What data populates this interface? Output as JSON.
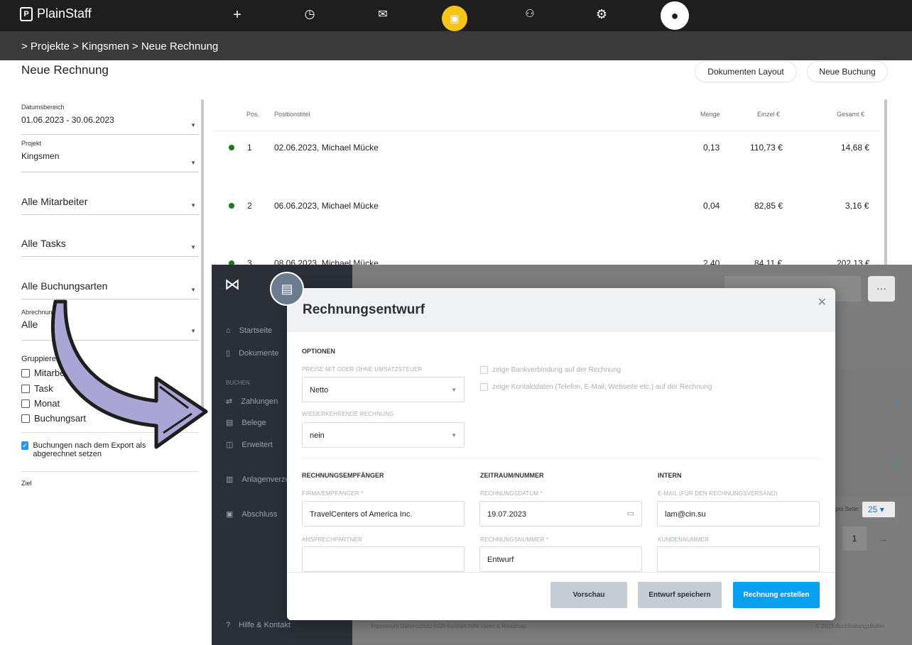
{
  "topbar": {
    "brand": "PlainStaff",
    "icons": [
      "plus-icon",
      "clock-icon",
      "mail-icon",
      "briefcase-icon",
      "team-icon",
      "gear-icon",
      "user-avatar-icon"
    ]
  },
  "breadcrumb": "> Projekte > Kingsmen > Neue Rechnung",
  "page_title": "Neue Rechnung",
  "buttons": {
    "layout": "Dokumenten Layout",
    "new_booking": "Neue Buchung"
  },
  "filters": {
    "date_label": "Datumsbereich",
    "date_value": "01.06.2023 - 30.06.2023",
    "project_label": "Projekt",
    "project_value": "Kingsmen",
    "employees": "Alle Mitarbeiter",
    "tasks": "Alle Tasks",
    "booking_types": "Alle Buchungsarten",
    "billing_label": "Abrechnung",
    "billing_value": "Alle"
  },
  "group_by": {
    "label": "Gruppieren nach",
    "options": [
      "Mitarbeiter",
      "Task",
      "Monat",
      "Buchungsart"
    ]
  },
  "export_option": "Buchungen nach dem Export als abgerechnet setzen",
  "ziel_label": "Ziel",
  "table": {
    "headers": {
      "pos": "Pos.",
      "title": "Positionstitel",
      "qty": "Menge",
      "unit": "Einzel €",
      "total": "Gesamt €"
    },
    "rows": [
      {
        "pos": "1",
        "title": "02.06.2023, Michael Mücke",
        "qty": "0,13",
        "unit": "110,73 €",
        "total": "14,68 €"
      },
      {
        "pos": "2",
        "title": "06.06.2023, Michael Mücke",
        "qty": "0,04",
        "unit": "82,85 €",
        "total": "3,16 €"
      },
      {
        "pos": "3",
        "title": "08.06.2023, Michael Mücke",
        "qty": "2,40",
        "unit": "84,11 €",
        "total": "202,13 €"
      }
    ]
  },
  "app_sidebar": {
    "items": [
      "Startseite",
      "Dokumente",
      "Zahlungen",
      "Belege",
      "Erweitert",
      "Anlagenverzeichnis",
      "Abschluss",
      "Hilfe & Kontakt"
    ],
    "section": "BUCHEN"
  },
  "app_footer": {
    "links": "Impressum  Datenschutz  AGB  Kontakt  Hilfe  Ideen & Roadmap",
    "copyright": "© 2023 BuchhaltungsButler"
  },
  "app_right": {
    "per_page_label": "pro Seite:",
    "per_page": "25",
    "page": "1",
    "more": "···"
  },
  "modal": {
    "title": "Rechnungsentwurf",
    "options_title": "OPTIONEN",
    "tax_label": "PREISE MIT ODER OHNE UMSATZSTEUER",
    "tax_value": "Netto",
    "recurring_label": "WIEDERKEHRENDE RECHNUNG",
    "recurring_value": "nein",
    "bank_check": "zeige Bankverbindung auf der Rechnung",
    "contact_check": "zeige Kontaktdaten (Telefon, E-Mail, Webseite etc.) auf der Rechnung",
    "recipient_title": "RECHNUNGSEMPFÄNGER",
    "company_label": "FIRMA/EMPFÄNGER *",
    "company_value": "TravelCenters of America Inc.",
    "contact_label": "ANSPRECHPARTNER",
    "period_title": "ZEITRAUM/NUMMER",
    "date_label": "RECHNUNGSDATUM *",
    "date_value": "19.07.2023",
    "number_label": "RECHNUNGSNUMMER *",
    "number_value": "Entwurf",
    "intern_title": "INTERN",
    "email_label": "E-MAIL (FÜR DEN RECHNUNGSVERSAND)",
    "email_value": "lam@cin.su",
    "customer_label": "KUNDENNUMMER",
    "btn_preview": "Vorschau",
    "btn_save": "Entwurf speichern",
    "btn_create": "Rechnung erstellen"
  },
  "colors": {
    "accent": "#0aa0f0",
    "topbar": "#1e1e1e",
    "status_green": "#1e7a1e",
    "arrow": "#a9a6d6"
  }
}
